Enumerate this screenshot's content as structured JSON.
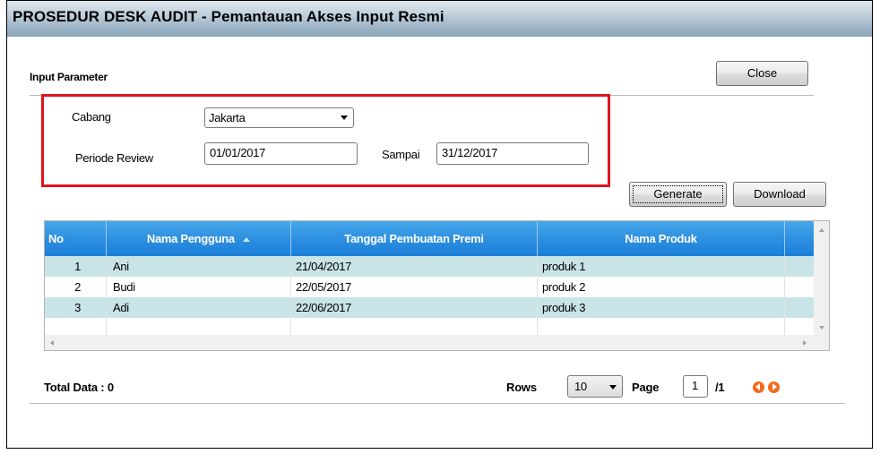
{
  "window": {
    "title": "PROSEDUR DESK AUDIT - Pemantauan Akses Input Resmi"
  },
  "section": {
    "title": "Input Parameter"
  },
  "buttons": {
    "close": "Close",
    "generate": "Generate",
    "download": "Download"
  },
  "form": {
    "cabang_label": "Cabang",
    "cabang_value": "Jakarta",
    "periode_label": "Periode Review",
    "periode_from": "01/01/2017",
    "sampai_label": "Sampai",
    "periode_to": "31/12/2017"
  },
  "table": {
    "columns": [
      "No",
      "Nama Pengguna",
      "Tanggal Pembuatan Premi",
      "Nama Produk"
    ],
    "sort_column": "Nama Pengguna",
    "rows": [
      {
        "no": "1",
        "nama": "Ani",
        "tanggal": "21/04/2017",
        "produk": "produk 1"
      },
      {
        "no": "2",
        "nama": "Budi",
        "tanggal": "22/05/2017",
        "produk": "produk 2"
      },
      {
        "no": "3",
        "nama": "Adi",
        "tanggal": "22/06/2017",
        "produk": "produk 3"
      }
    ]
  },
  "footer": {
    "total_label": "Total Data : 0",
    "rows_label": "Rows",
    "rows_value": "10",
    "page_label": "Page",
    "page_value": "1",
    "page_total": "/1"
  },
  "colors": {
    "header_blue": "#2b8ee0",
    "row_alt": "#c9e4e6",
    "highlight_border": "#e0141e",
    "nav_orange": "#f36a1c"
  }
}
